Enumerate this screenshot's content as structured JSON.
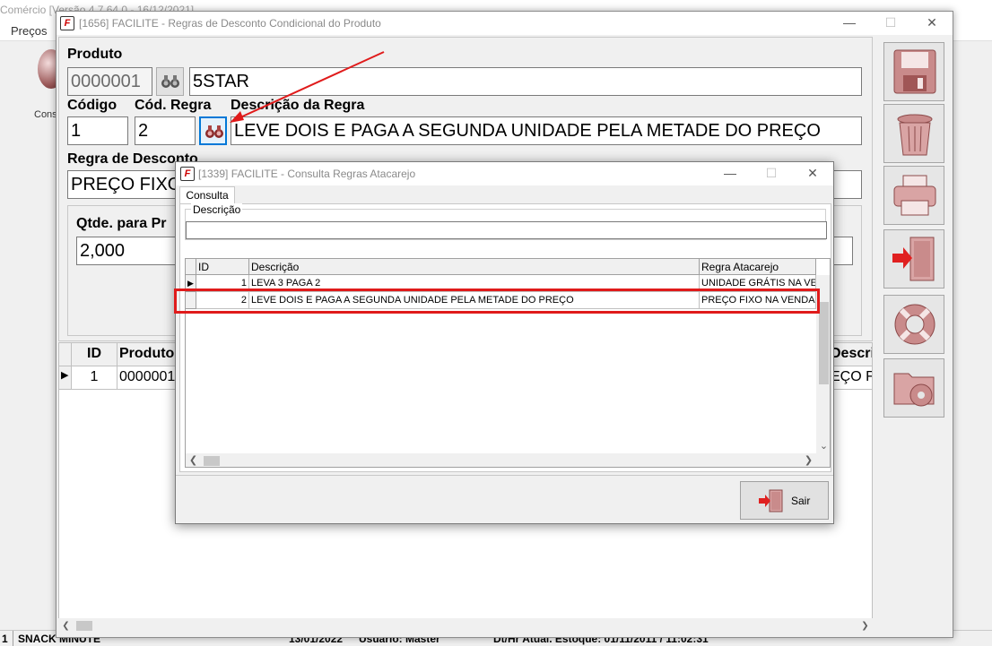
{
  "background_app": {
    "title": "Comércio [Versão 4.7.64.0 - 16/12/2021]",
    "menu_item": "Preços",
    "left_button_label": "Cons",
    "status_segments": [
      "1",
      "SNACK MINUTE",
      "13/01/2022",
      "Usuário: Master",
      "Dt/Hr Atual. Estoque: 01/11/2011 / 11:02:31"
    ]
  },
  "main_window": {
    "title": "[1656] FACILITE - Regras de Desconto Condicional do Produto",
    "produto_label": "Produto",
    "produto_code": "0000001",
    "produto_name": "5STAR",
    "codigo_label": "Código",
    "codigo_value": "1",
    "cod_regra_label": "Cód. Regra",
    "cod_regra_value": "2",
    "descricao_regra_label": "Descrição da Regra",
    "descricao_regra_value": "LEVE DOIS E PAGA A SEGUNDA UNIDADE PELA METADE DO PREÇO",
    "regra_desconto_label": "Regra de Desconto",
    "regra_desconto_value": "PREÇO FIXO",
    "qtde_label": "Qtde. para Pr",
    "qtde_value": "2,000",
    "grid": {
      "columns": [
        "ID",
        "Produto",
        "Descriç"
      ],
      "rows": [
        {
          "indicator": "▶",
          "id": "1",
          "produto": "0000001",
          "descricao": "EÇO FI"
        }
      ]
    },
    "side_buttons": [
      "save-icon",
      "trash-icon",
      "printer-icon",
      "exit-door-icon",
      "lifebuoy-icon",
      "folder-settings-icon"
    ]
  },
  "dialog": {
    "title": "[1339] FACILITE - Consulta Regras Atacarejo",
    "tab_label": "Consulta",
    "descricao_label": "Descrição",
    "descricao_value": "",
    "grid": {
      "columns": [
        "ID",
        "Descrição",
        "Regra Atacarejo"
      ],
      "rows": [
        {
          "indicator": "▶",
          "id": "1",
          "descricao": "LEVA 3 PAGA 2",
          "regra": "UNIDADE GRÁTIS NA VE"
        },
        {
          "indicator": "",
          "id": "2",
          "descricao": "LEVE DOIS E PAGA A SEGUNDA UNIDADE PELA METADE DO PREÇO",
          "regra": "PREÇO FIXO NA VENDA"
        }
      ]
    },
    "sair_label": "Sair"
  },
  "colors": {
    "annotation_red": "#e01b1b",
    "focus_blue": "#0078d7",
    "icon_rose": "#c98b8b"
  }
}
